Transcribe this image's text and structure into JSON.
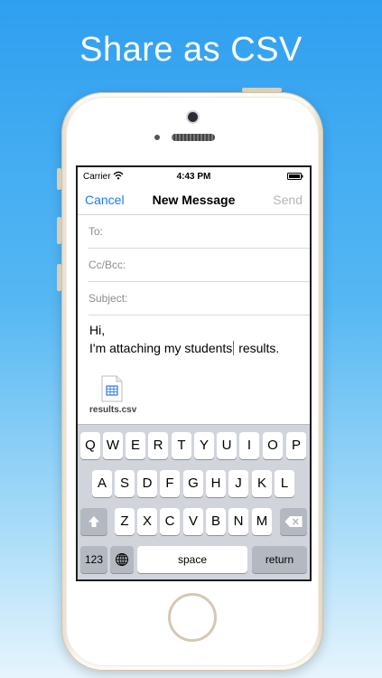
{
  "headline": "Share as CSV",
  "status": {
    "carrier": "Carrier",
    "time": "4:43 PM"
  },
  "nav": {
    "cancel": "Cancel",
    "title": "New Message",
    "send": "Send"
  },
  "fields": {
    "to": "To:",
    "cc": "Cc/Bcc:",
    "subject": "Subject:"
  },
  "body": {
    "line1": "Hi,",
    "line2_before_caret": "I'm attaching my students",
    "line2_after_caret": " results."
  },
  "attachment": {
    "name": "results.csv",
    "icon": "spreadsheet-file-icon"
  },
  "keyboard": {
    "row1": [
      "Q",
      "W",
      "E",
      "R",
      "T",
      "Y",
      "U",
      "I",
      "O",
      "P"
    ],
    "row2": [
      "A",
      "S",
      "D",
      "F",
      "G",
      "H",
      "J",
      "K",
      "L"
    ],
    "row3": [
      "Z",
      "X",
      "C",
      "V",
      "B",
      "N",
      "M"
    ],
    "numbers": "123",
    "space": "space",
    "return": "return",
    "shift_icon": "shift-icon",
    "delete_icon": "delete-icon",
    "globe_icon": "globe-icon"
  },
  "colors": {
    "accent": "#1a7cf0",
    "background_top": "#2f9ff0",
    "keyboard": "#d1d5db"
  }
}
